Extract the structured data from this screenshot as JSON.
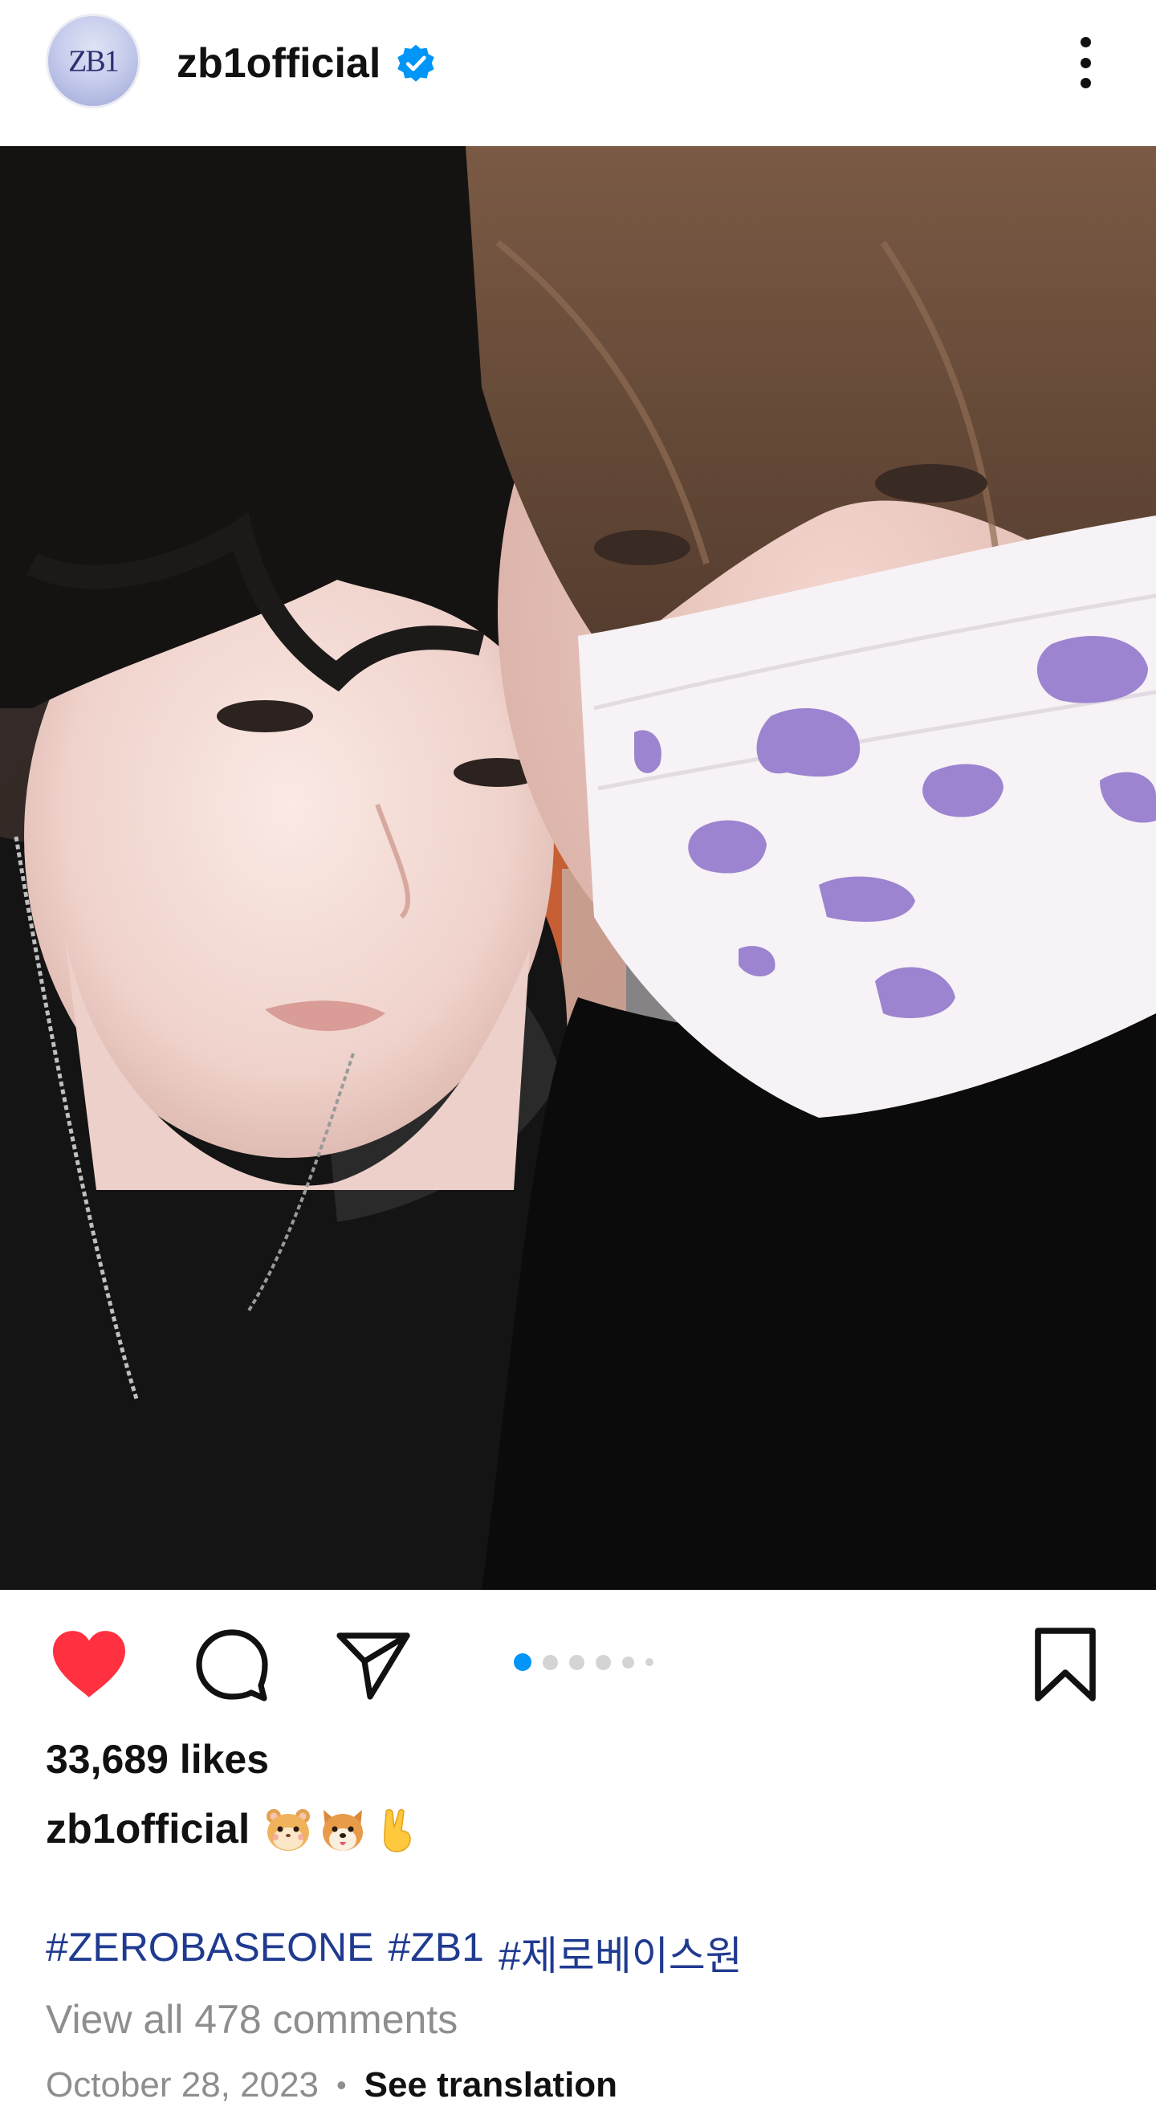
{
  "header": {
    "username": "zb1official",
    "avatar_text": "ZB1",
    "verified": true,
    "verified_icon": "verified-badge-icon",
    "more_icon": "more-vertical-icon"
  },
  "post": {
    "photo_alt": "selfie photo",
    "carousel": {
      "total": 6,
      "active_index": 0
    },
    "liked": true
  },
  "actions": {
    "like_icon": "heart-filled-icon",
    "comment_icon": "comment-icon",
    "share_icon": "send-icon",
    "save_icon": "bookmark-icon"
  },
  "likes_text": "33,689 likes",
  "caption": {
    "username": "zb1official",
    "emojis": [
      "🐹",
      "🐶",
      "✌️"
    ]
  },
  "hashtags": [
    "#ZEROBASEONE",
    "#ZB1",
    "#제로베이스원"
  ],
  "view_comments": "View all 478 comments",
  "date": "October 28, 2023",
  "separator": "•",
  "see_translation": "See translation",
  "colors": {
    "like_red": "#ff3040",
    "link_blue": "#1f3a8f",
    "dot_active": "#0095f6",
    "muted": "#8e8e8e",
    "verified_blue": "#0095f6"
  }
}
